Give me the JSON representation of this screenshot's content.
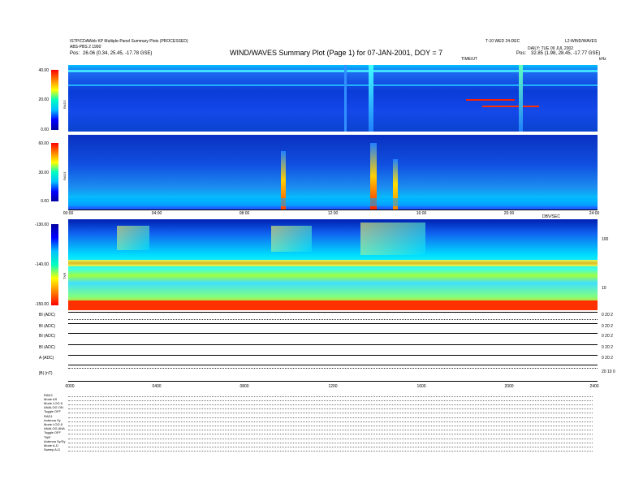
{
  "header": {
    "left_line1": "ISTP/CDAWeb KP Multiple-Panel Summary Plots (PROCESSED)",
    "left_line2": "ABS-PBS 2 1990",
    "left_pos_label": "Pos:",
    "left_pos_value": "26.06 (0.34, 25.45, -17.78 GSE)",
    "title": "WIND/WAVES Summary Plot (Page 1) for 07-JAN-2001, DOY = 7",
    "right_line1a": "T-10 WED 24-DEC",
    "right_line1b": "L2:WIND/WAVES",
    "right_line2": "DAILY: TUE 09 JUL 2002",
    "right_pos_label": "Pos:",
    "right_pos_value": "32.85 (1.98, 28.45, -17.77 GSE)",
    "top_marker": "TIME/UT",
    "khz_label": "kHz"
  },
  "rad2": {
    "cbar_ticks": [
      "40.00",
      "20.00",
      "0.00"
    ],
    "label": "RAD2"
  },
  "rad1": {
    "cbar_ticks": [
      "60.00",
      "30.00",
      "0.00"
    ],
    "label": "RAD1"
  },
  "tnr": {
    "cbar_ticks": [
      "-130.00",
      "-140.00",
      "-150.00"
    ],
    "label": "TNR",
    "right_ticks": [
      "100",
      "10"
    ],
    "top_marker": "DBV/SEC"
  },
  "time_axis_1": [
    "00:00",
    "04:00",
    "08:00",
    "12:00",
    "16:00",
    "20:00",
    "24:00"
  ],
  "time_axis_2": [
    "0000",
    "0400",
    "0800",
    "1200",
    "1600",
    "2000",
    "2400"
  ],
  "bottom_panels": [
    {
      "label": "BI (ADC)",
      "right": "0 20 2"
    },
    {
      "label": "BI (ADC)",
      "right": "0 20 2"
    },
    {
      "label": "BI (ADC)",
      "right": "0 20 2"
    },
    {
      "label": "BI (ADC)",
      "right": "0 20 2"
    },
    {
      "label": "A (ADC)",
      "right": "0 20 2"
    },
    {
      "label": "|B| (nT)",
      "right": "20 10 0"
    }
  ],
  "footer": [
    "RAD2",
    "Mode    AS",
    "Mode    LOG 8",
    "ANALOG  ON",
    "Toggle  OFF",
    "RAD1",
    "Antenna  Sy",
    "Mode    LOG 8",
    "ANALOG  ANA",
    "Toggle  OFF",
    "TNR",
    "Antenna  Sy/Sy",
    "Mode    A-D",
    "Sweep   A-D"
  ],
  "chart_data": {
    "type": "heatmap",
    "title": "WIND/WAVES Summary Plot (Page 1) for 07-JAN-2001, DOY = 7",
    "panels": [
      {
        "name": "RAD2",
        "colorbar_range": [
          0,
          40
        ]
      },
      {
        "name": "RAD1",
        "colorbar_range": [
          0,
          60
        ]
      },
      {
        "name": "TNR",
        "colorbar_range": [
          -150,
          -130
        ]
      }
    ],
    "x": [
      "00:00",
      "04:00",
      "08:00",
      "12:00",
      "16:00",
      "20:00",
      "24:00"
    ],
    "colors": {
      "low": "#0000ff",
      "mid": "#00ffff",
      "high": "#ff0000"
    }
  }
}
